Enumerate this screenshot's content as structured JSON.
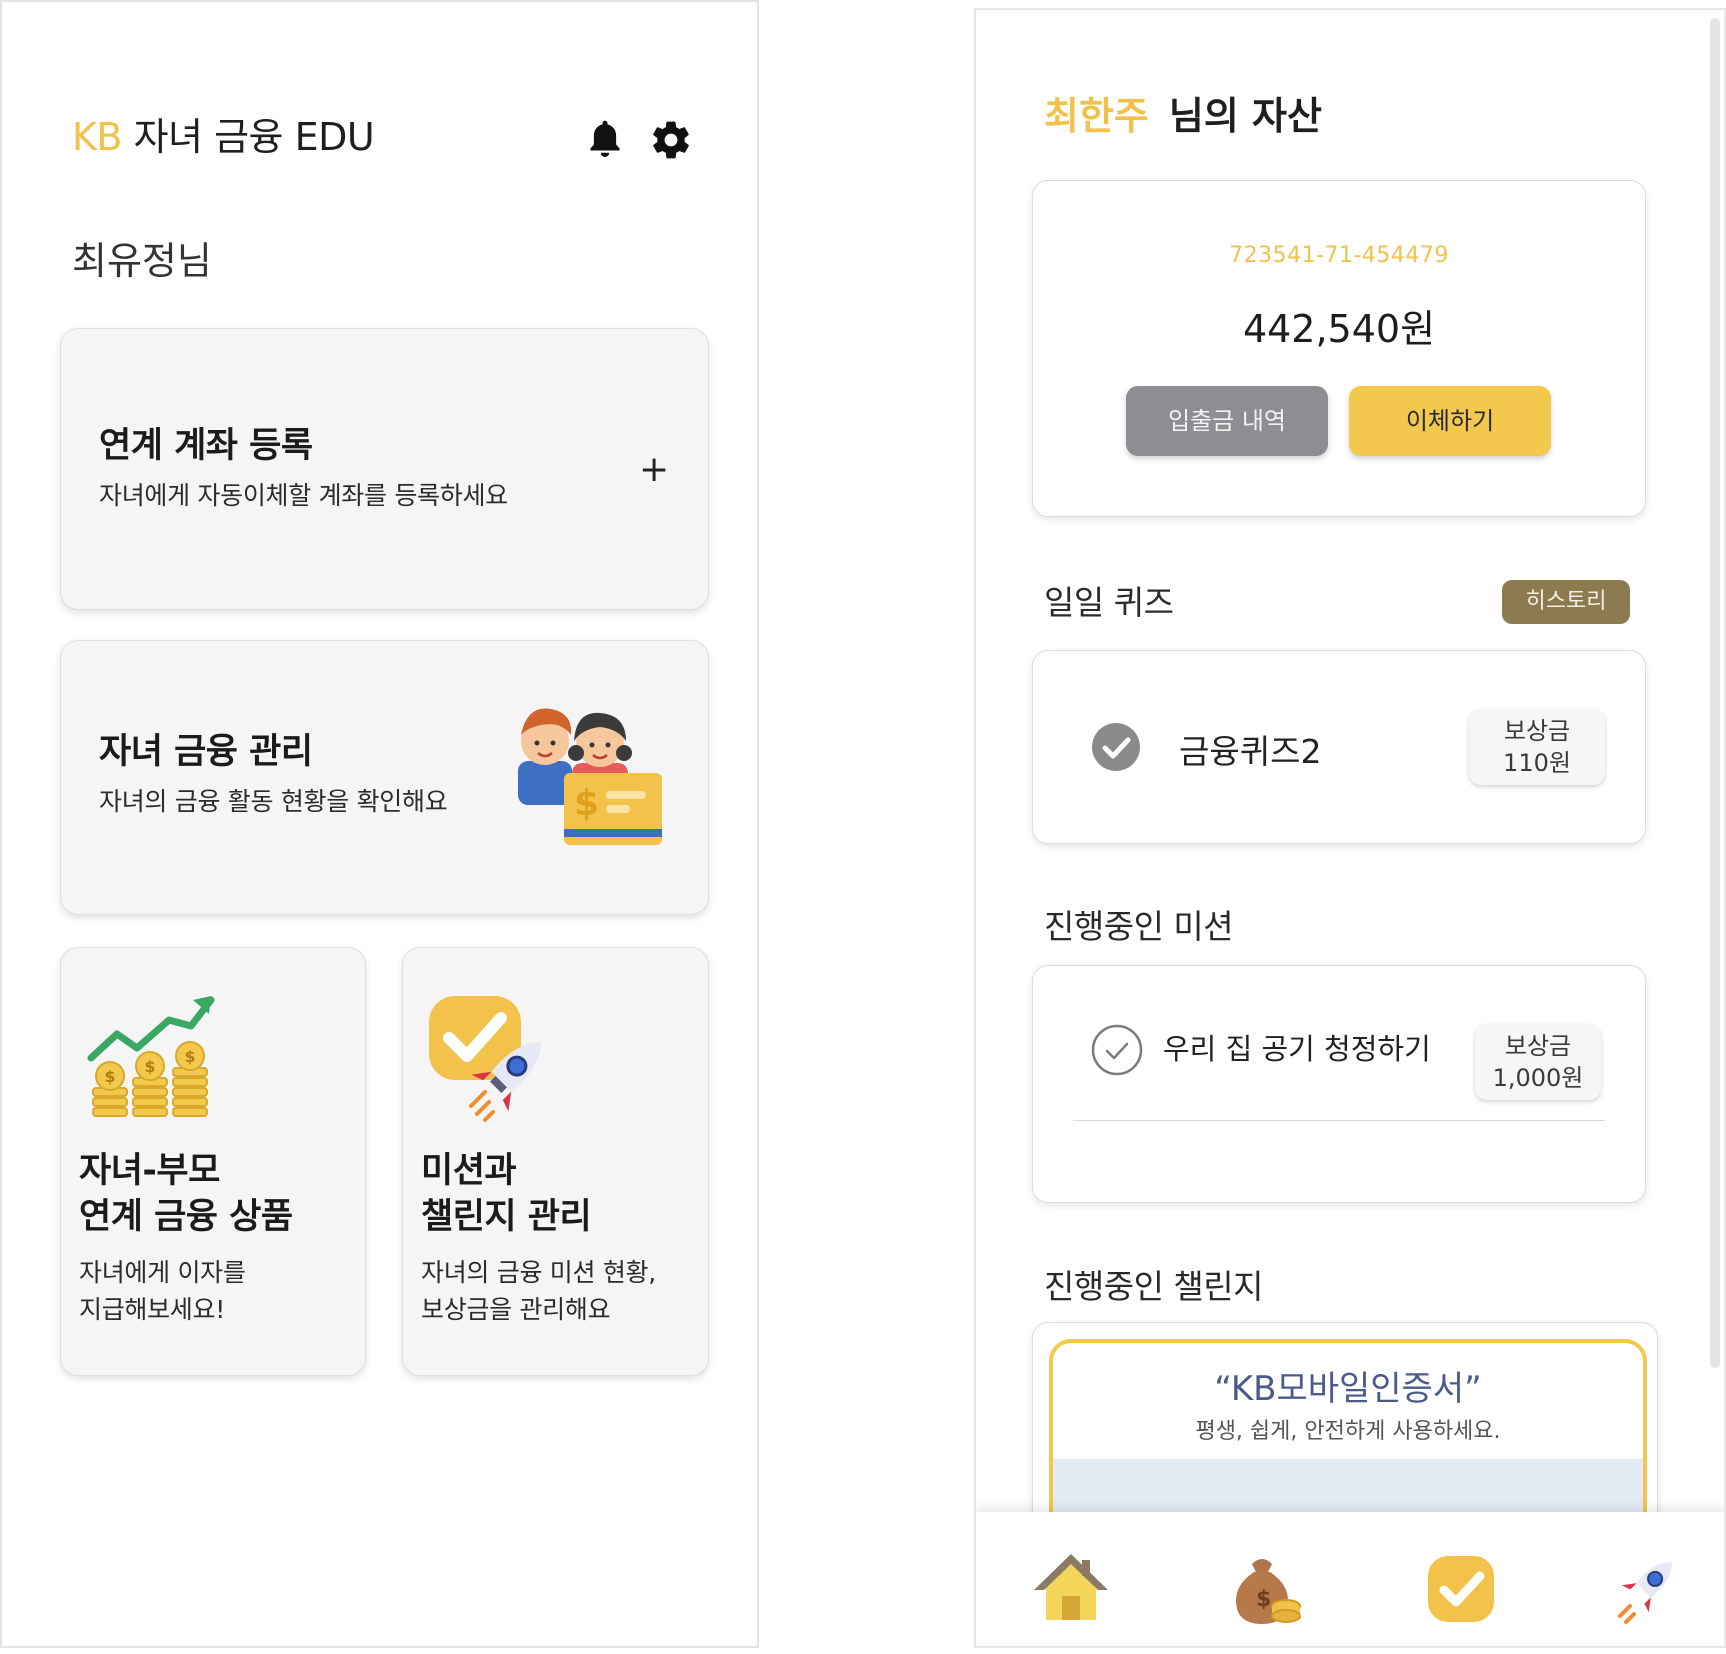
{
  "left": {
    "header": {
      "title_kb": "KB",
      "title_rest": " 자녀 금융 EDU",
      "bell_icon": "bell-icon",
      "settings_icon": "gear-icon"
    },
    "greeting": "최유정님",
    "cards": {
      "link_account": {
        "title": "연계 계좌 등록",
        "desc": "자녀에게 자동이체할 계좌를 등록하세요",
        "action": "+"
      },
      "child_finance": {
        "title": "자녀 금융 관리",
        "desc": "자녀의 금융 활동 현황을 확인해요"
      },
      "product": {
        "title_line1": "자녀-부모",
        "title_line2": "연계 금융 상품",
        "desc_line1": "자녀에게 이자를",
        "desc_line2": "지급해보세요!"
      },
      "mission": {
        "title_line1": "미션과",
        "title_line2": "챌린지 관리",
        "desc_line1": "자녀의 금융 미션 현황,",
        "desc_line2": "보상금을 관리해요"
      }
    }
  },
  "right": {
    "owner_name": "최한주",
    "owner_suffix": "님의 자산",
    "account": {
      "number": "723541-71-454479",
      "balance": "442,540원",
      "history_button": "입출금 내역",
      "transfer_button": "이체하기"
    },
    "quiz": {
      "section_label": "일일 퀴즈",
      "history_button": "히스토리",
      "item_title": "금융퀴즈2",
      "reward_label": "보상금",
      "reward_amount": "110원"
    },
    "mission": {
      "section_label": "진행중인 미션",
      "item_title": "우리 집 공기 청정하기",
      "reward_label": "보상금",
      "reward_amount": "1,000원"
    },
    "challenge": {
      "section_label": "진행중인 챌린지",
      "banner_title": "“KB모바일인증서”",
      "banner_sub": "평생, 쉽게, 안전하게 사용하세요."
    },
    "bottom_nav": [
      "home-icon",
      "money-bag-icon",
      "checkmark-icon",
      "rocket-icon"
    ]
  },
  "colors": {
    "accent_gold": "#f2c94c",
    "kb_yellow": "#f0c24b",
    "history_brown": "#8c7a50",
    "gray_button": "#8d8e91"
  }
}
